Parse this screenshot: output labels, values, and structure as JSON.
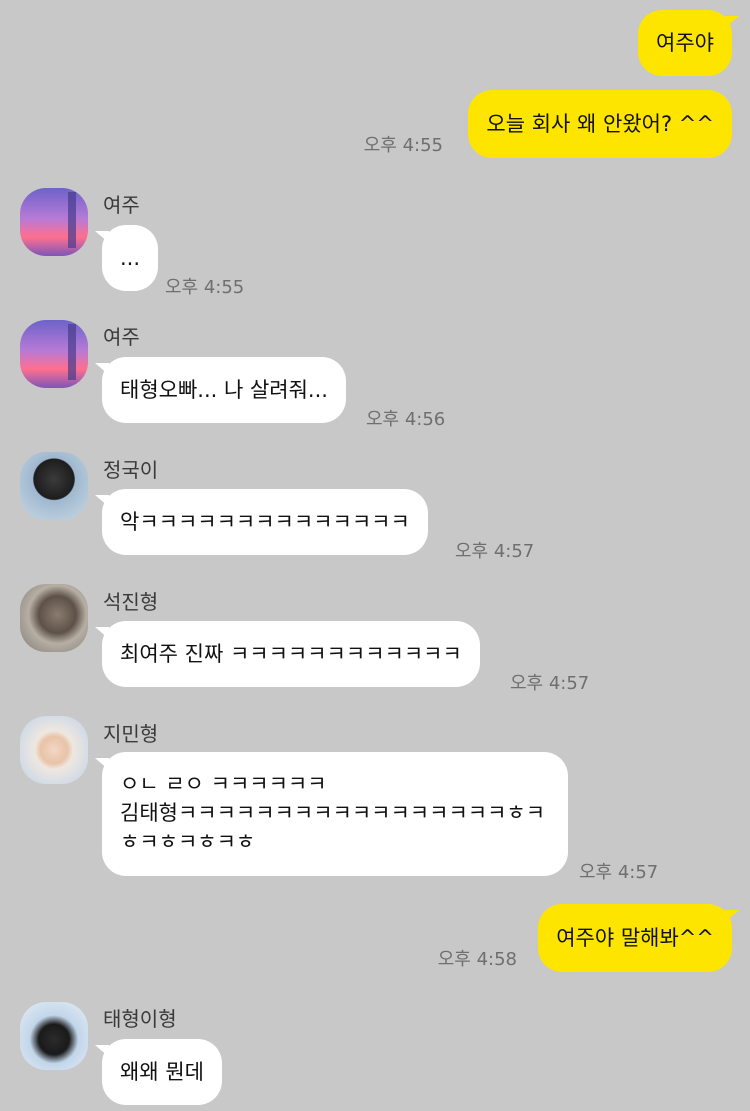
{
  "messages": [
    {
      "text": "여주야"
    },
    {
      "text": "오늘 회사 왜 안왔어? ^^",
      "time": "오후 4:55"
    },
    {
      "sender": "여주",
      "text": "...",
      "time": "오후 4:55"
    },
    {
      "sender": "여주",
      "text": "태형오빠... 나 살려줘...",
      "time": "오후 4:56"
    },
    {
      "sender": "정국이",
      "text": "악ㅋㅋㅋㅋㅋㅋㅋㅋㅋㅋㅋㅋㅋㅋ",
      "time": "오후 4:57"
    },
    {
      "sender": "석진형",
      "text": "최여주 진짜 ㅋㅋㅋㅋㅋㅋㅋㅋㅋㅋㅋㅋ",
      "time": "오후 4:57"
    },
    {
      "sender": "지민형",
      "text": "ㅇㄴ ㄹㅇ ㅋㅋㅋㅋㅋㅋ\n김태형ㅋㅋㅋㅋㅋㅋㅋㅋㅋㅋㅋㅋㅋㅋㅋㅋㅋㅎㅋ\nㅎㅋㅎㅋㅎㅋㅎ",
      "time": "오후 4:57"
    },
    {
      "text": "여주야 말해봐^^",
      "time": "오후 4:58"
    },
    {
      "sender": "태형이형",
      "text": "왜왜 뭔데"
    }
  ],
  "avatars": [
    "purple-sky-photo",
    "dark-coat-photo",
    "rock-photo",
    "fur-hood-photo",
    "black-coat-photo"
  ],
  "colors": {
    "background": "#c8c8c8",
    "my_bubble": "#fee500",
    "their_bubble": "#ffffff"
  }
}
